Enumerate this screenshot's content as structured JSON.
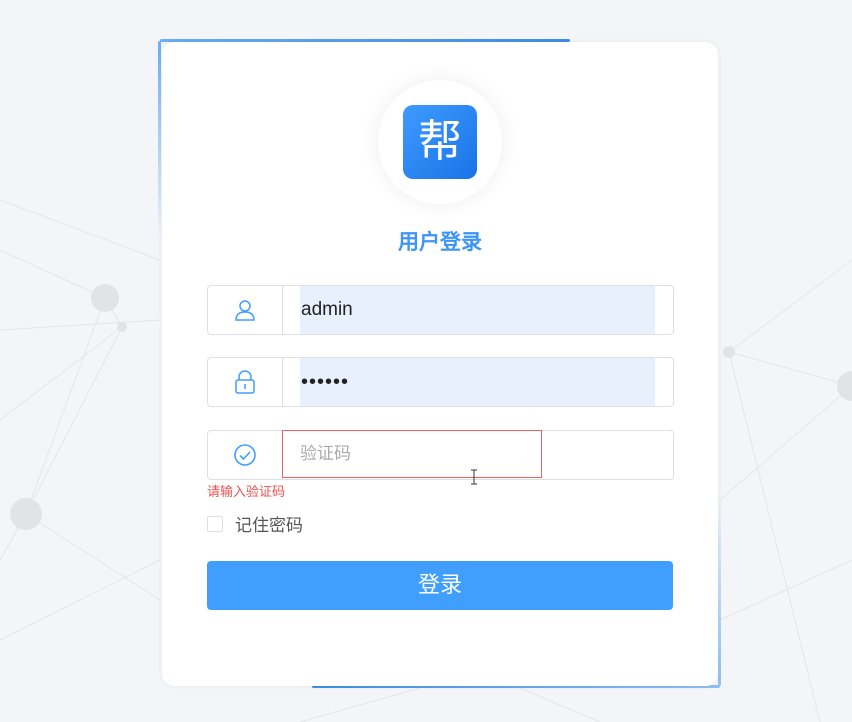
{
  "logo": {
    "char": "帮"
  },
  "title": "用户登录",
  "username": {
    "value": "admin",
    "icon": "user-icon"
  },
  "password": {
    "value": "••••••",
    "icon": "lock-icon"
  },
  "captcha": {
    "placeholder": "验证码",
    "icon": "check-circle-icon",
    "error": "请输入验证码"
  },
  "remember": {
    "label": "记住密码",
    "checked": false
  },
  "login_button": "登录",
  "colors": {
    "accent": "#409eff",
    "title": "#3d95f5",
    "error": "#f05050",
    "autofill": "#e8f0fe"
  }
}
